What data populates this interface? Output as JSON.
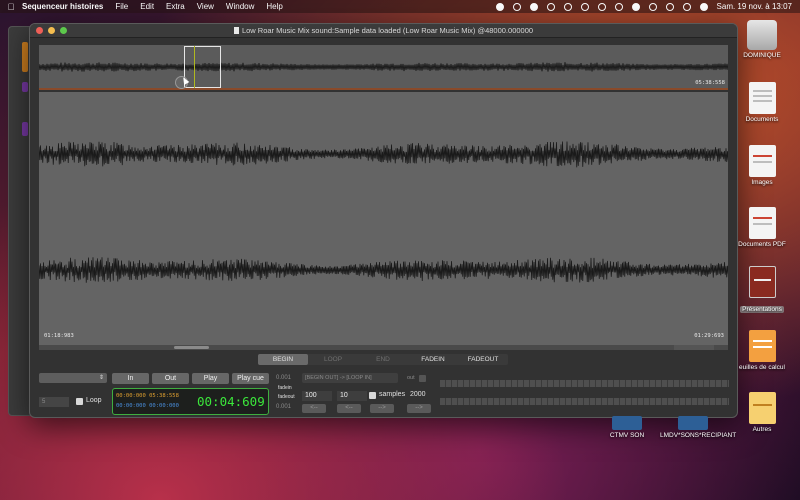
{
  "menubar": {
    "app": "Sequenceur histoires",
    "items": [
      "File",
      "Edit",
      "Extra",
      "View",
      "Window",
      "Help"
    ],
    "clock": "Sam. 19 nov. à 13:07"
  },
  "window": {
    "title": "Low Roar Music Mix sound:Sample data loaded (Low Roar Music Mix) @48000.000000"
  },
  "overview": {
    "end_time": "05:38:558"
  },
  "waveform": {
    "start_time": "01:18:983",
    "end_time": "01:29:693"
  },
  "tabs": [
    {
      "label": "BEGIN",
      "state": "active"
    },
    {
      "label": "LOOP",
      "state": "disabled"
    },
    {
      "label": "END",
      "state": "disabled"
    },
    {
      "label": "FADEIN",
      "state": "normal"
    },
    {
      "label": "FADEOUT",
      "state": "normal"
    }
  ],
  "controls": {
    "in_label": "In",
    "out_label": "Out",
    "play_label": "Play",
    "playcue_label": "Play cue",
    "loop_count": "5",
    "loop_label": "Loop",
    "value_a": "0.001",
    "value_b": "0.001",
    "range_field": "[BEGIN OUT] -> [LOOP IN]",
    "out_label_small": "out",
    "fadein_label": "fadein",
    "fadeout_label": "fadeout",
    "fade_value_1": "100",
    "fade_value_2": "10",
    "samples_label": "samples",
    "samples_value": "2000",
    "arrow_left": "<--",
    "arrow_right": "-->"
  },
  "timecode": {
    "line1": "00:00:000 05:38:558",
    "line2": "00:00:000 00:00:000",
    "current": "00:04:609",
    "colors": {
      "green": "#3be63b",
      "orange": "#e0a030",
      "blue": "#4a90e0"
    }
  },
  "desktop": {
    "items": [
      {
        "label": "DOMINIQUE",
        "icon": "drive-icon"
      },
      {
        "label": "Documents",
        "icon": "document-icon"
      },
      {
        "label": "Images",
        "icon": "image-file-icon"
      },
      {
        "label": "Documents PDF",
        "icon": "pdf-icon"
      },
      {
        "label": "Présentations",
        "icon": "presentation-icon"
      },
      {
        "label": "euilles de calcul",
        "icon": "spreadsheet-icon"
      },
      {
        "label": "Autres",
        "icon": "other-files-icon"
      },
      {
        "label": "CTMV SON",
        "icon": "folder-icon"
      },
      {
        "label": "LMDV*SONS*RECIPIANT",
        "icon": "folder-icon"
      }
    ]
  }
}
